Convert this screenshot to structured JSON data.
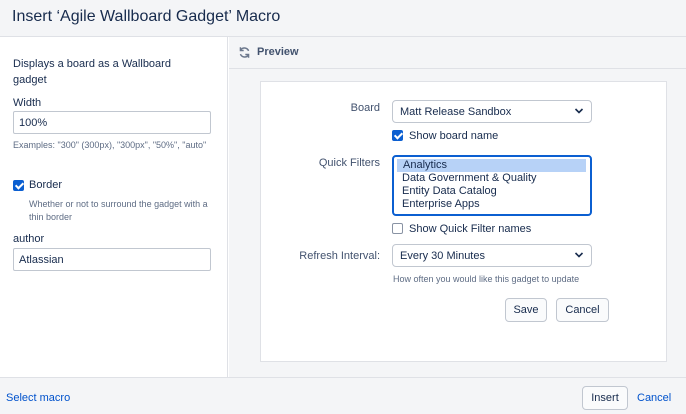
{
  "dialog": {
    "title": "Insert ‘Agile Wallboard Gadget’ Macro"
  },
  "sidebar": {
    "description": "Displays a board as a Wallboard gadget",
    "width_label": "Width",
    "width_value": "100%",
    "width_help": "Examples: \"300\" (300px), \"300px\", \"50%\", \"auto\"",
    "border_label": "Border",
    "border_checked": true,
    "border_help": "Whether or not to surround the gadget with a thin border",
    "author_label": "author",
    "author_value": "Atlassian"
  },
  "preview": {
    "title": "Preview",
    "board_label": "Board",
    "board_value": "Matt Release Sandbox",
    "show_board_name_label": "Show board name",
    "show_board_name_checked": true,
    "quick_filters_label": "Quick Filters",
    "quick_filters": [
      {
        "label": "Analytics",
        "selected": true
      },
      {
        "label": "Data Government & Quality",
        "selected": false
      },
      {
        "label": "Entity Data Catalog",
        "selected": false
      },
      {
        "label": "Enterprise Apps",
        "selected": false
      }
    ],
    "show_quick_filter_names_label": "Show Quick Filter names",
    "show_quick_filter_names_checked": false,
    "refresh_label": "Refresh Interval:",
    "refresh_value": "Every 30 Minutes",
    "refresh_help": "How often you would like this gadget to update",
    "save_label": "Save",
    "cancel_label": "Cancel"
  },
  "footer": {
    "select_macro": "Select macro",
    "insert": "Insert",
    "cancel": "Cancel"
  },
  "colors": {
    "accent": "#0b5fd1",
    "link": "#0052cc",
    "panel_bg": "#f4f5f7",
    "border": "#dfe1e6"
  },
  "icons": [
    "refresh-icon",
    "chevron-down-icon",
    "checkmark-icon"
  ]
}
